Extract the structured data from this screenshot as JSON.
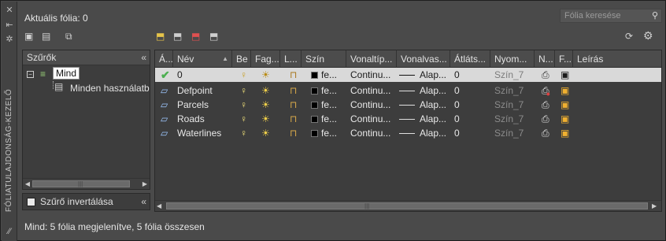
{
  "palette": {
    "title": "FÓLIATULAJDONSÁG-KEZELŐ"
  },
  "current_layer": "Aktuális fólia: 0",
  "search": {
    "placeholder": "Fólia keresése"
  },
  "filters": {
    "header": "Szűrők",
    "tree": [
      {
        "label": "Mind",
        "level": 0,
        "expanded": true,
        "selected": true
      },
      {
        "label": "Minden használatban",
        "level": 1,
        "expanded": false,
        "selected": false
      }
    ],
    "invert_label": "Szűrő invertálása",
    "invert_checked": false
  },
  "grid": {
    "columns": [
      "Á...",
      "Név",
      "Be",
      "Fag...",
      "L...",
      "Szín",
      "Vonaltíp...",
      "Vonalvas...",
      "Átláts...",
      "Nyom...",
      "N...",
      "F...",
      "Leírás"
    ],
    "rows": [
      {
        "status": "current",
        "name": "0",
        "color": "fe...",
        "linetype": "Continu...",
        "lineweight": "Alap...",
        "transparency": "0",
        "plotstyle": "Szín_7",
        "selected": true
      },
      {
        "status": "normal",
        "name": "Defpoint",
        "color": "fe...",
        "linetype": "Continu...",
        "lineweight": "Alap...",
        "transparency": "0",
        "plotstyle": "Szín_7",
        "selected": false
      },
      {
        "status": "normal",
        "name": "Parcels",
        "color": "fe...",
        "linetype": "Continu...",
        "lineweight": "Alap...",
        "transparency": "0",
        "plotstyle": "Szín_7",
        "selected": false
      },
      {
        "status": "normal",
        "name": "Roads",
        "color": "fe...",
        "linetype": "Continu...",
        "lineweight": "Alap...",
        "transparency": "0",
        "plotstyle": "Szín_7",
        "selected": false
      },
      {
        "status": "normal",
        "name": "Waterlines",
        "color": "fe...",
        "linetype": "Continu...",
        "lineweight": "Alap...",
        "transparency": "0",
        "plotstyle": "Szín_7",
        "selected": false
      }
    ]
  },
  "status_bar": "Mind: 5 fólia megjelenítve, 5 fólia összesen",
  "icons": {
    "current": "checkmark-icon",
    "layer": "layer-parallelogram-icon",
    "on": "lightbulb-icon",
    "freeze": "sun-icon",
    "lock": "unlocked-padlock-icon",
    "plot": "printer-icon",
    "vp_freeze": "new-viewport-freeze-icon"
  },
  "colors": {
    "selection": "#d9d9d9",
    "panel": "#3d3d3d",
    "header": "#4c4c4c",
    "current_check": "#4caf50"
  }
}
